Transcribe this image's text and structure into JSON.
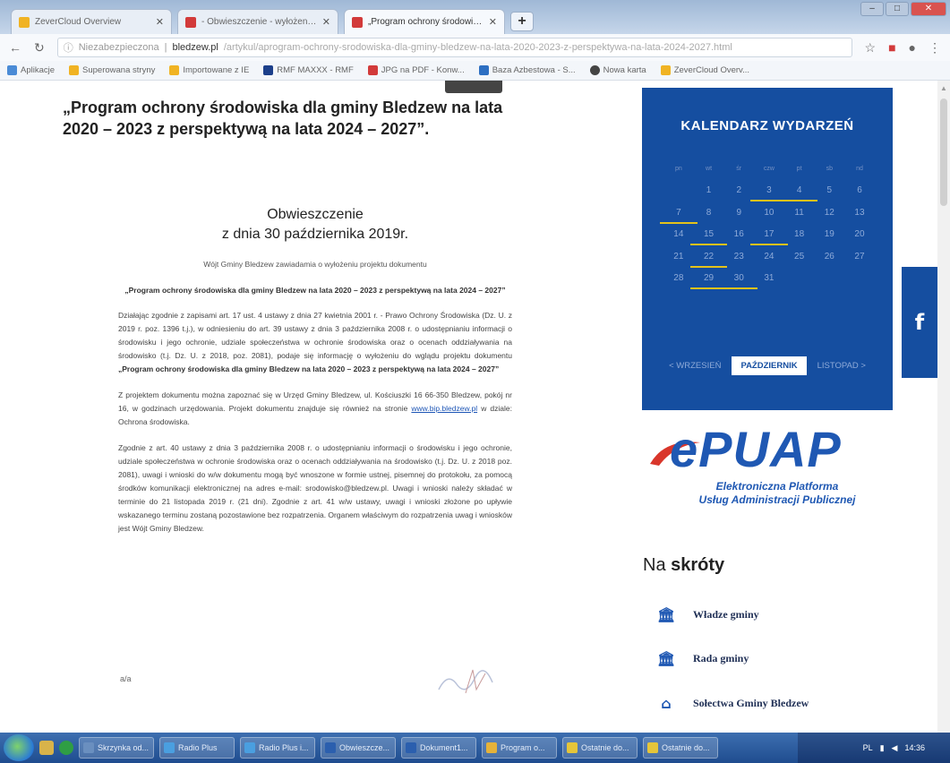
{
  "browser": {
    "tabs": [
      {
        "title": "ZeverCloud Overview",
        "color": "#f0b323"
      },
      {
        "title": "- Obwieszczenie - wyłożenie do",
        "color": "#d23a3a"
      },
      {
        "title": "„Program ochrony środowiska",
        "color": "#d23a3a"
      }
    ],
    "new_tab": "+",
    "url_security": "Niezabezpieczona",
    "url_host": "bledzew.pl",
    "url_path": "/artykul/aprogram-ochrony-srodowiska-dla-gminy-bledzew-na-lata-2020-2023-z-perspektywa-na-lata-2024-2027.html",
    "bookmarks": [
      {
        "label": "Aplikacje",
        "color": "#4a8bd6"
      },
      {
        "label": "Superowana stryny",
        "color": "#f0b323"
      },
      {
        "label": "Importowane z IE",
        "color": "#f0b323"
      },
      {
        "label": "RMF MAXXX - RMF",
        "color": "#1c3f8a"
      },
      {
        "label": "JPG na PDF - Konw...",
        "color": "#d23a3a"
      },
      {
        "label": "Baza Azbestowa - S...",
        "color": "#2d6fc2"
      },
      {
        "label": "Nowa karta",
        "color": "#444444"
      },
      {
        "label": "ZeverCloud Overv...",
        "color": "#f0b323"
      }
    ]
  },
  "page": {
    "title": "„Program ochrony środowiska dla gminy Bledzew na lata 2020 – 2023 z perspektywą na lata 2024 – 2027”.",
    "doc_heading_1": "Obwieszczenie",
    "doc_heading_2": "z dnia 30 października 2019r.",
    "doc_intro": "Wójt Gminy Bledzew zawiadamia o wyłożeniu projektu dokumentu",
    "doc_subtitle": "„Program ochrony środowiska dla gminy Bledzew na lata 2020 – 2023 z perspektywą na lata 2024 – 2027”",
    "para1": "Działając zgodnie z zapisami art. 17 ust. 4 ustawy z dnia 27 kwietnia 2001 r. - Prawo Ochrony Środowiska (Dz. U. z 2019 r. poz. 1396 t.j.), w odniesieniu do art. 39 ustawy z dnia 3 października 2008 r. o udostępnianiu informacji o środowisku i jego ochronie, udziale społeczeństwa w ochronie środowiska oraz o ocenach oddziaływania na środowisko (t.j. Dz. U. z 2018, poz. 2081), podaje się informację o wyłożeniu do wglądu projektu dokumentu",
    "para1_bold": "„Program ochrony środowiska dla gminy Bledzew na lata 2020 – 2023 z perspektywą na lata 2024 – 2027”",
    "para2_a": "Z projektem dokumentu można zapoznać się w Urzęd Gminy Bledzew, ul. Kościuszki 16 66-350 Bledzew, pokój nr 16, w godzinach urzędowania. Projekt dokumentu znajduje się również na stronie",
    "para2_link": "www.bip.bledzew.pl",
    "para2_b": "w dziale: Ochrona środowiska.",
    "para3": "Zgodnie z art. 40 ustawy z dnia 3 października 2008 r. o udostępnianiu informacji o środowisku i jego ochronie, udziale społeczeństwa w ochronie środowiska oraz o ocenach oddziaływania na środowisko (t.j. Dz. U. z 2018 poz. 2081), uwagi i wnioski do w/w dokumentu mogą być wnoszone w formie ustnej, pisemnej do protokołu, za pomocą środków komunikacji elektronicznej na adres e-mail: srodowisko@bledzew.pl. Uwagi i wnioski należy składać w terminie do 21 listopada 2019 r. (21 dni). Zgodnie z art. 41 w/w ustawy, uwagi i wnioski złożone po upływie wskazanego terminu zostaną pozostawione bez rozpatrzenia. Organem właściwym do rozpatrzenia uwag i wniosków jest Wójt Gminy Bledzew.",
    "sig": "a/a"
  },
  "calendar": {
    "title": "KALENDARZ WYDARZEŃ",
    "day_headers": [
      "pn",
      "wt",
      "śr",
      "czw",
      "pt",
      "sb",
      "nd"
    ],
    "weeks": [
      [
        "",
        "1",
        "2",
        "3",
        "4",
        "5",
        "6"
      ],
      [
        "7",
        "8",
        "9",
        "10",
        "11",
        "12",
        "13"
      ],
      [
        "14",
        "15",
        "16",
        "17",
        "18",
        "19",
        "20"
      ],
      [
        "21",
        "22",
        "23",
        "24",
        "25",
        "26",
        "27"
      ],
      [
        "28",
        "29",
        "30",
        "31",
        "",
        "",
        ""
      ]
    ],
    "event_days": [
      "3",
      "4",
      "7",
      "15",
      "17",
      "22",
      "29",
      "30"
    ],
    "prev": "< WRZESIEŃ",
    "current": "PAŹDZIERNIK",
    "next": "LISTOPAD >"
  },
  "facebook": "f",
  "epuap": {
    "logo": "ePUAP",
    "line1": "Elektroniczna Platforma",
    "line2": "Usług Administracji Publicznej",
    "accent": "#1f58b3",
    "swoosh": "#d9362b"
  },
  "shortcuts": {
    "title_a": "Na ",
    "title_b": "skróty",
    "items": [
      {
        "label": "Władze gminy",
        "icon": "building-icon"
      },
      {
        "label": "Rada gminy",
        "icon": "building-icon"
      },
      {
        "label": "Sołectwa Gminy Bledzew",
        "icon": "village-icon"
      }
    ]
  },
  "taskbar": {
    "items": [
      "Skrzynka od...",
      "Radio Plus",
      "Radio Plus i...",
      "Obwieszcze...",
      "Dokument1...",
      "Program o...",
      "Ostatnie do...",
      "Ostatnie do..."
    ],
    "time": "14:36"
  }
}
